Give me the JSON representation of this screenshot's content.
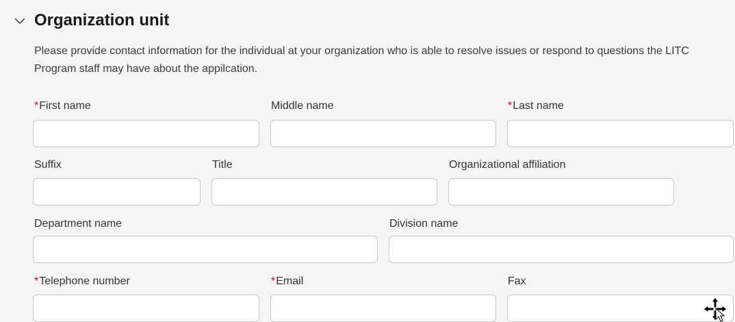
{
  "section": {
    "title": "Organization unit",
    "description": "Please provide contact information for the individual at your organization who is able to resolve issues or respond to questions the LITC Program staff may have about the appilcation.",
    "required_marker": "*"
  },
  "fields": {
    "first_name": {
      "label": "First name",
      "required": true,
      "value": ""
    },
    "middle_name": {
      "label": "Middle name",
      "required": false,
      "value": ""
    },
    "last_name": {
      "label": "Last name",
      "required": true,
      "value": ""
    },
    "suffix": {
      "label": "Suffix",
      "required": false,
      "value": ""
    },
    "title": {
      "label": "Title",
      "required": false,
      "value": ""
    },
    "org_affiliation": {
      "label": "Organizational affiliation",
      "required": false,
      "value": ""
    },
    "department_name": {
      "label": "Department name",
      "required": false,
      "value": ""
    },
    "division_name": {
      "label": "Division name",
      "required": false,
      "value": ""
    },
    "telephone": {
      "label": "Telephone number",
      "required": true,
      "value": ""
    },
    "email": {
      "label": "Email",
      "required": true,
      "value": ""
    },
    "fax": {
      "label": "Fax",
      "required": false,
      "value": ""
    }
  },
  "colors": {
    "required": "#d0021b",
    "panel_background": "#f5f5f8",
    "input_border": "#c6c6cc"
  },
  "icons": {
    "section_toggle": "chevron-down-icon",
    "mouse_cursor": "move-cursor-icon"
  }
}
